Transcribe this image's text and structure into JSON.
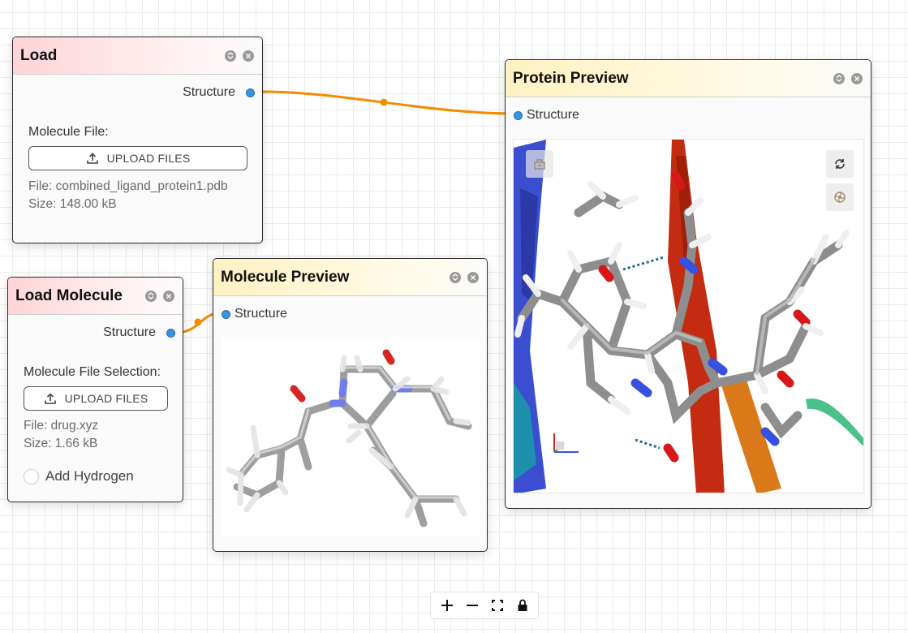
{
  "nodes": {
    "load": {
      "title": "Load",
      "output_port": "Structure",
      "field_label": "Molecule File:",
      "upload_label": "UPLOAD FILES",
      "file": "File: combined_ligand_protein1.pdb",
      "size": "Size: 148.00 kB"
    },
    "load_molecule": {
      "title": "Load Molecule",
      "output_port": "Structure",
      "field_label": "Molecule File Selection:",
      "upload_label": "UPLOAD FILES",
      "file": "File: drug.xyz",
      "size": "Size: 1.66 kB",
      "checkbox_label": "Add Hydrogen",
      "checkbox_checked": false
    },
    "molecule_preview": {
      "title": "Molecule Preview",
      "input_port": "Structure"
    },
    "protein_preview": {
      "title": "Protein Preview",
      "input_port": "Structure"
    }
  },
  "icons": {
    "node_header": [
      "collapse-icon",
      "close-icon"
    ],
    "viewer_tools": [
      "screenshot-icon",
      "refresh-icon",
      "spin-icon"
    ],
    "canvas_controls": [
      "zoom-in-icon",
      "zoom-out-icon",
      "fit-view-icon",
      "lock-icon"
    ]
  },
  "colors": {
    "edge": "#f28c00",
    "port": "#3a93dd",
    "load_header": "#ffd4d8",
    "preview_header": "#fff1c2",
    "carbon": "#a8a8a8",
    "nitrogen": "#3b55d8",
    "oxygen": "#d61a1a",
    "hydrogen": "#f2f2f2"
  }
}
